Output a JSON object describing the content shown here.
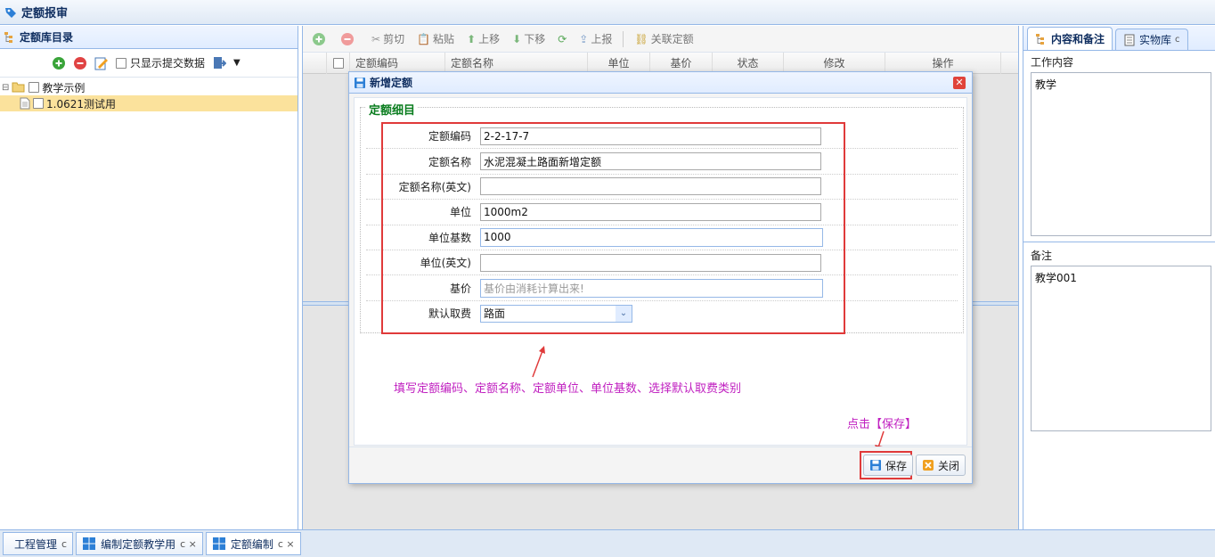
{
  "app": {
    "title": "定额报审"
  },
  "left": {
    "title": "定额库目录",
    "checkbox_label": "只显示提交数据",
    "tree": [
      {
        "label": "教学示例"
      },
      {
        "label": "1.0621测试用"
      }
    ]
  },
  "center": {
    "toolbar": [
      "剪切",
      "粘贴",
      "上移",
      "下移",
      "上报",
      "关联定额"
    ],
    "columns": [
      "定额编码",
      "定额名称",
      "单位",
      "基价",
      "状态",
      "修改",
      "操作"
    ]
  },
  "right": {
    "tabs": [
      "内容和备注",
      "实物库"
    ],
    "work_label": "工作内容",
    "work_value": "教学",
    "note_label": "备注",
    "note_value": "教学001"
  },
  "modal": {
    "title": "新增定额",
    "legend": "定额细目",
    "fields": [
      {
        "label": "定额编码",
        "value": "2-2-17-7"
      },
      {
        "label": "定额名称",
        "value": "水泥混凝土路面新增定额"
      },
      {
        "label": "定额名称(英文)",
        "value": ""
      },
      {
        "label": "单位",
        "value": "1000m2"
      },
      {
        "label": "单位基数",
        "value": "1000"
      },
      {
        "label": "单位(英文)",
        "value": ""
      },
      {
        "label": "基价",
        "placeholder": "基价由消耗计算出来!"
      },
      {
        "label": "默认取费",
        "value": "路面"
      }
    ],
    "annotation": "填写定额编码、定额名称、定额单位、单位基数、选择默认取费类别",
    "save_hint": "点击【保存】",
    "save_label": "保存",
    "close_label": "关闭"
  },
  "bottom_tabs": [
    {
      "label": "工程管理",
      "mark": "c"
    },
    {
      "label": "编制定额教学用",
      "mark": "c ×"
    },
    {
      "label": "定额编制",
      "mark": "c ×"
    }
  ],
  "tab_mark": "c",
  "colors": {
    "accent": "#95b8e7",
    "highlight": "#e03a3a",
    "annotation": "#c020c0",
    "legend": "#0a7d1f"
  }
}
